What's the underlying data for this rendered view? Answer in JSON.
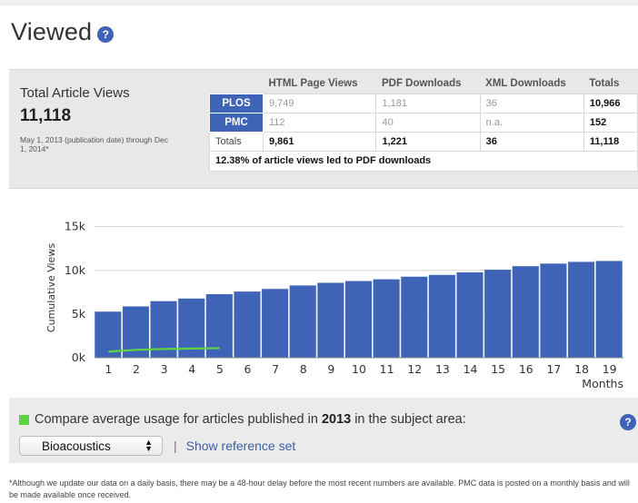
{
  "heading": {
    "title": "Viewed",
    "help_icon": "?"
  },
  "summary": {
    "total_label": "Total Article Views",
    "total_value": "11,118",
    "date_note": "May 1, 2013 (publication date) through Dec 1, 2014*",
    "columns": [
      "HTML Page Views",
      "PDF Downloads",
      "XML Downloads",
      "Totals"
    ],
    "rows": [
      {
        "source": "PLOS",
        "values": [
          "9,749",
          "1,181",
          "36",
          "10,966"
        ]
      },
      {
        "source": "PMC",
        "values": [
          "112",
          "40",
          "n.a.",
          "152"
        ]
      }
    ],
    "totals": {
      "label": "Totals",
      "values": [
        "9,861",
        "1,221",
        "36",
        "11,118"
      ]
    },
    "pdf_note": "12.38% of article views led to PDF downloads"
  },
  "chart_data": {
    "type": "bar",
    "ylabel": "Cumulative Views",
    "xlabel": "Months",
    "ylim": [
      0,
      16000
    ],
    "yticks": [
      0,
      5000,
      10000,
      15000
    ],
    "ytick_labels": [
      "0k",
      "5k",
      "10k",
      "15k"
    ],
    "categories": [
      "1",
      "2",
      "3",
      "4",
      "5",
      "6",
      "7",
      "8",
      "9",
      "10",
      "11",
      "12",
      "13",
      "14",
      "15",
      "16",
      "17",
      "18",
      "19"
    ],
    "series": [
      {
        "values": [
          5300,
          5900,
          6500,
          6800,
          7300,
          7600,
          7900,
          8300,
          8600,
          8800,
          9000,
          9300,
          9500,
          9800,
          10100,
          10500,
          10800,
          11000,
          11100
        ]
      },
      {
        "values": [
          700,
          900,
          1000,
          1050,
          1100
        ]
      }
    ],
    "colors": {
      "bars": "#3f63b6",
      "line": "#5ed443"
    }
  },
  "compare": {
    "text_before": "Compare average usage for articles published in",
    "year": "2013",
    "text_after": "in the subject area:",
    "select_value": "Bioacoustics",
    "link": "Show reference set",
    "separator": "|"
  },
  "footnote": "*Although we update our data on a daily basis, there may be a 48-hour delay before the most recent numbers are available. PMC data is posted on a monthly basis and will be made available once received."
}
